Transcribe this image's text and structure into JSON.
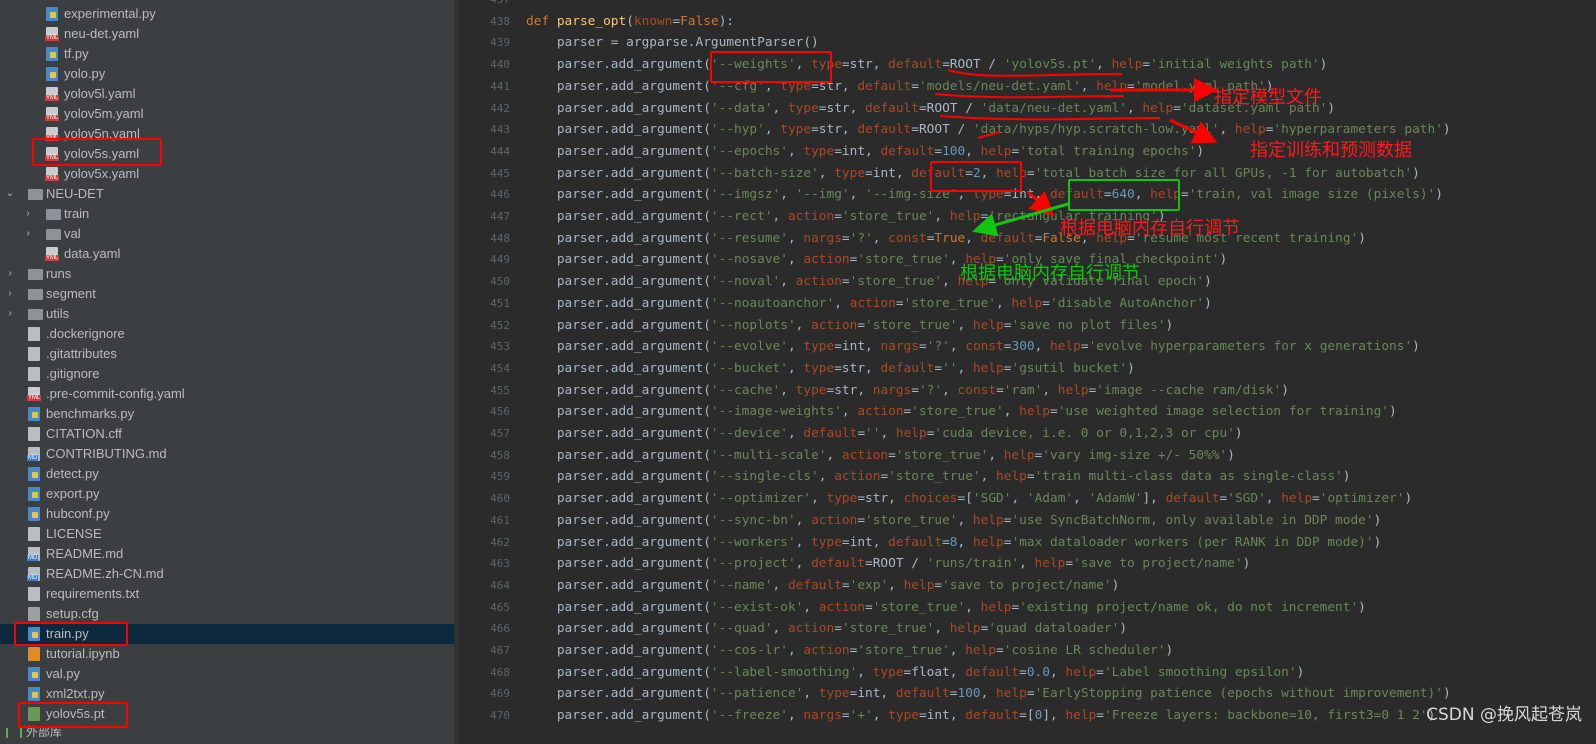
{
  "sidebar": {
    "items": [
      {
        "label": "experimental.py",
        "type": "py"
      },
      {
        "label": "neu-det.yaml",
        "type": "yaml"
      },
      {
        "label": "tf.py",
        "type": "py"
      },
      {
        "label": "yolo.py",
        "type": "py"
      },
      {
        "label": "yolov5l.yaml",
        "type": "yaml"
      },
      {
        "label": "yolov5m.yaml",
        "type": "yaml"
      },
      {
        "label": "yolov5n.yaml",
        "type": "yaml"
      },
      {
        "label": "yolov5s.yaml",
        "type": "yaml"
      },
      {
        "label": "yolov5x.yaml",
        "type": "yaml"
      },
      {
        "label": "NEU-DET",
        "type": "folder"
      },
      {
        "label": "train",
        "type": "folder"
      },
      {
        "label": "val",
        "type": "folder"
      },
      {
        "label": "data.yaml",
        "type": "yaml"
      },
      {
        "label": "runs",
        "type": "folder"
      },
      {
        "label": "segment",
        "type": "folder"
      },
      {
        "label": "utils",
        "type": "folder"
      },
      {
        "label": ".dockerignore",
        "type": "text"
      },
      {
        "label": ".gitattributes",
        "type": "text"
      },
      {
        "label": ".gitignore",
        "type": "text"
      },
      {
        "label": ".pre-commit-config.yaml",
        "type": "yaml"
      },
      {
        "label": "benchmarks.py",
        "type": "py"
      },
      {
        "label": "CITATION.cff",
        "type": "text"
      },
      {
        "label": "CONTRIBUTING.md",
        "type": "md"
      },
      {
        "label": "detect.py",
        "type": "py"
      },
      {
        "label": "export.py",
        "type": "py"
      },
      {
        "label": "hubconf.py",
        "type": "py"
      },
      {
        "label": "LICENSE",
        "type": "text"
      },
      {
        "label": "README.md",
        "type": "md"
      },
      {
        "label": "README.zh-CN.md",
        "type": "md"
      },
      {
        "label": "requirements.txt",
        "type": "text"
      },
      {
        "label": "setup.cfg",
        "type": "cfg"
      },
      {
        "label": "train.py",
        "type": "py"
      },
      {
        "label": "tutorial.ipynb",
        "type": "nb"
      },
      {
        "label": "val.py",
        "type": "py"
      },
      {
        "label": "xml2txt.py",
        "type": "py"
      },
      {
        "label": "yolov5s.pt",
        "type": "pt"
      }
    ],
    "external_libraries": "外部库"
  },
  "editor": {
    "line_numbers": [
      "437",
      "438",
      "439",
      "440",
      "441",
      "442",
      "443",
      "444",
      "445",
      "446",
      "447",
      "448",
      "449",
      "450",
      "451",
      "452",
      "453",
      "454",
      "455",
      "456",
      "457",
      "458",
      "459",
      "460",
      "461",
      "462",
      "463",
      "464",
      "465",
      "466",
      "467",
      "468",
      "469",
      "470"
    ],
    "lines": [
      "",
      "def parse_opt(known=False):",
      "    parser = argparse.ArgumentParser()",
      "    parser.add_argument('--weights', type=str, default=ROOT / 'yolov5s.pt', help='initial weights path')",
      "    parser.add_argument('--cfg', type=str, default='models/neu-det.yaml', help='model.yaml path')",
      "    parser.add_argument('--data', type=str, default=ROOT / 'data/neu-det.yaml', help='dataset.yaml path')",
      "    parser.add_argument('--hyp', type=str, default=ROOT / 'data/hyps/hyp.scratch-low.yaml', help='hyperparameters path')",
      "    parser.add_argument('--epochs', type=int, default=100, help='total training epochs')",
      "    parser.add_argument('--batch-size', type=int, default=2, help='total batch size for all GPUs, -1 for autobatch')",
      "    parser.add_argument('--imgsz', '--img', '--img-size', type=int, default=640, help='train, val image size (pixels)')",
      "    parser.add_argument('--rect', action='store_true', help='rectangular training')",
      "    parser.add_argument('--resume', nargs='?', const=True, default=False, help='resume most recent training')",
      "    parser.add_argument('--nosave', action='store_true', help='only save final checkpoint')",
      "    parser.add_argument('--noval', action='store_true', help='only validate final epoch')",
      "    parser.add_argument('--noautoanchor', action='store_true', help='disable AutoAnchor')",
      "    parser.add_argument('--noplots', action='store_true', help='save no plot files')",
      "    parser.add_argument('--evolve', type=int, nargs='?', const=300, help='evolve hyperparameters for x generations')",
      "    parser.add_argument('--bucket', type=str, default='', help='gsutil bucket')",
      "    parser.add_argument('--cache', type=str, nargs='?', const='ram', help='image --cache ram/disk')",
      "    parser.add_argument('--image-weights', action='store_true', help='use weighted image selection for training')",
      "    parser.add_argument('--device', default='', help='cuda device, i.e. 0 or 0,1,2,3 or cpu')",
      "    parser.add_argument('--multi-scale', action='store_true', help='vary img-size +/- 50%%')",
      "    parser.add_argument('--single-cls', action='store_true', help='train multi-class data as single-class')",
      "    parser.add_argument('--optimizer', type=str, choices=['SGD', 'Adam', 'AdamW'], default='SGD', help='optimizer')",
      "    parser.add_argument('--sync-bn', action='store_true', help='use SyncBatchNorm, only available in DDP mode')",
      "    parser.add_argument('--workers', type=int, default=8, help='max dataloader workers (per RANK in DDP mode)')",
      "    parser.add_argument('--project', default=ROOT / 'runs/train', help='save to project/name')",
      "    parser.add_argument('--name', default='exp', help='save to project/name')",
      "    parser.add_argument('--exist-ok', action='store_true', help='existing project/name ok, do not increment')",
      "    parser.add_argument('--quad', action='store_true', help='quad dataloader')",
      "    parser.add_argument('--cos-lr', action='store_true', help='cosine LR scheduler')",
      "    parser.add_argument('--label-smoothing', type=float, default=0.0, help='Label smoothing epsilon')",
      "    parser.add_argument('--patience', type=int, default=100, help='EarlyStopping patience (epochs without improvement)')",
      "    parser.add_argument('--freeze', nargs='+', type=int, default=[0], help='Freeze layers: backbone=10, first3=0 1 2')"
    ]
  },
  "annotations": {
    "model_file": "指定模型文件",
    "train_data": "指定训练和预测数据",
    "adjust_red": "根据电脑内存自行调节",
    "adjust_green": "根据电脑内存自行调节"
  },
  "watermark": "CSDN @挽风起苍岚",
  "colors": {
    "annotation_red": "#ff0000",
    "annotation_green": "#13c50f",
    "sidebar_bg": "#3c3f41",
    "editor_bg": "#2b2b2b",
    "selected_row": "#0d293e"
  }
}
